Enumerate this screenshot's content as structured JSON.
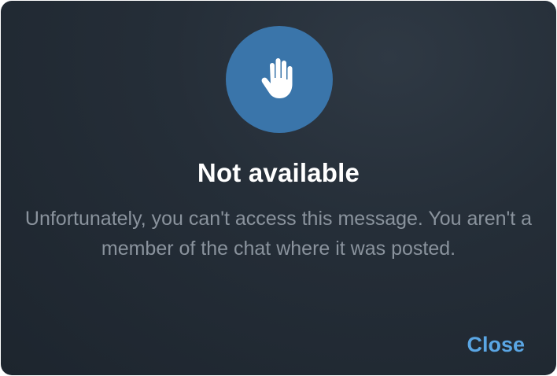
{
  "dialog": {
    "icon": "raised-hand-icon",
    "title": "Not available",
    "message": "Unfortunately, you can't access this message. You aren't a member of the chat where it was posted.",
    "close_label": "Close"
  },
  "colors": {
    "background": "#252e38",
    "icon_circle": "#3a75aa",
    "title": "#ffffff",
    "message": "#8a939d",
    "accent": "#5aa6e4"
  }
}
